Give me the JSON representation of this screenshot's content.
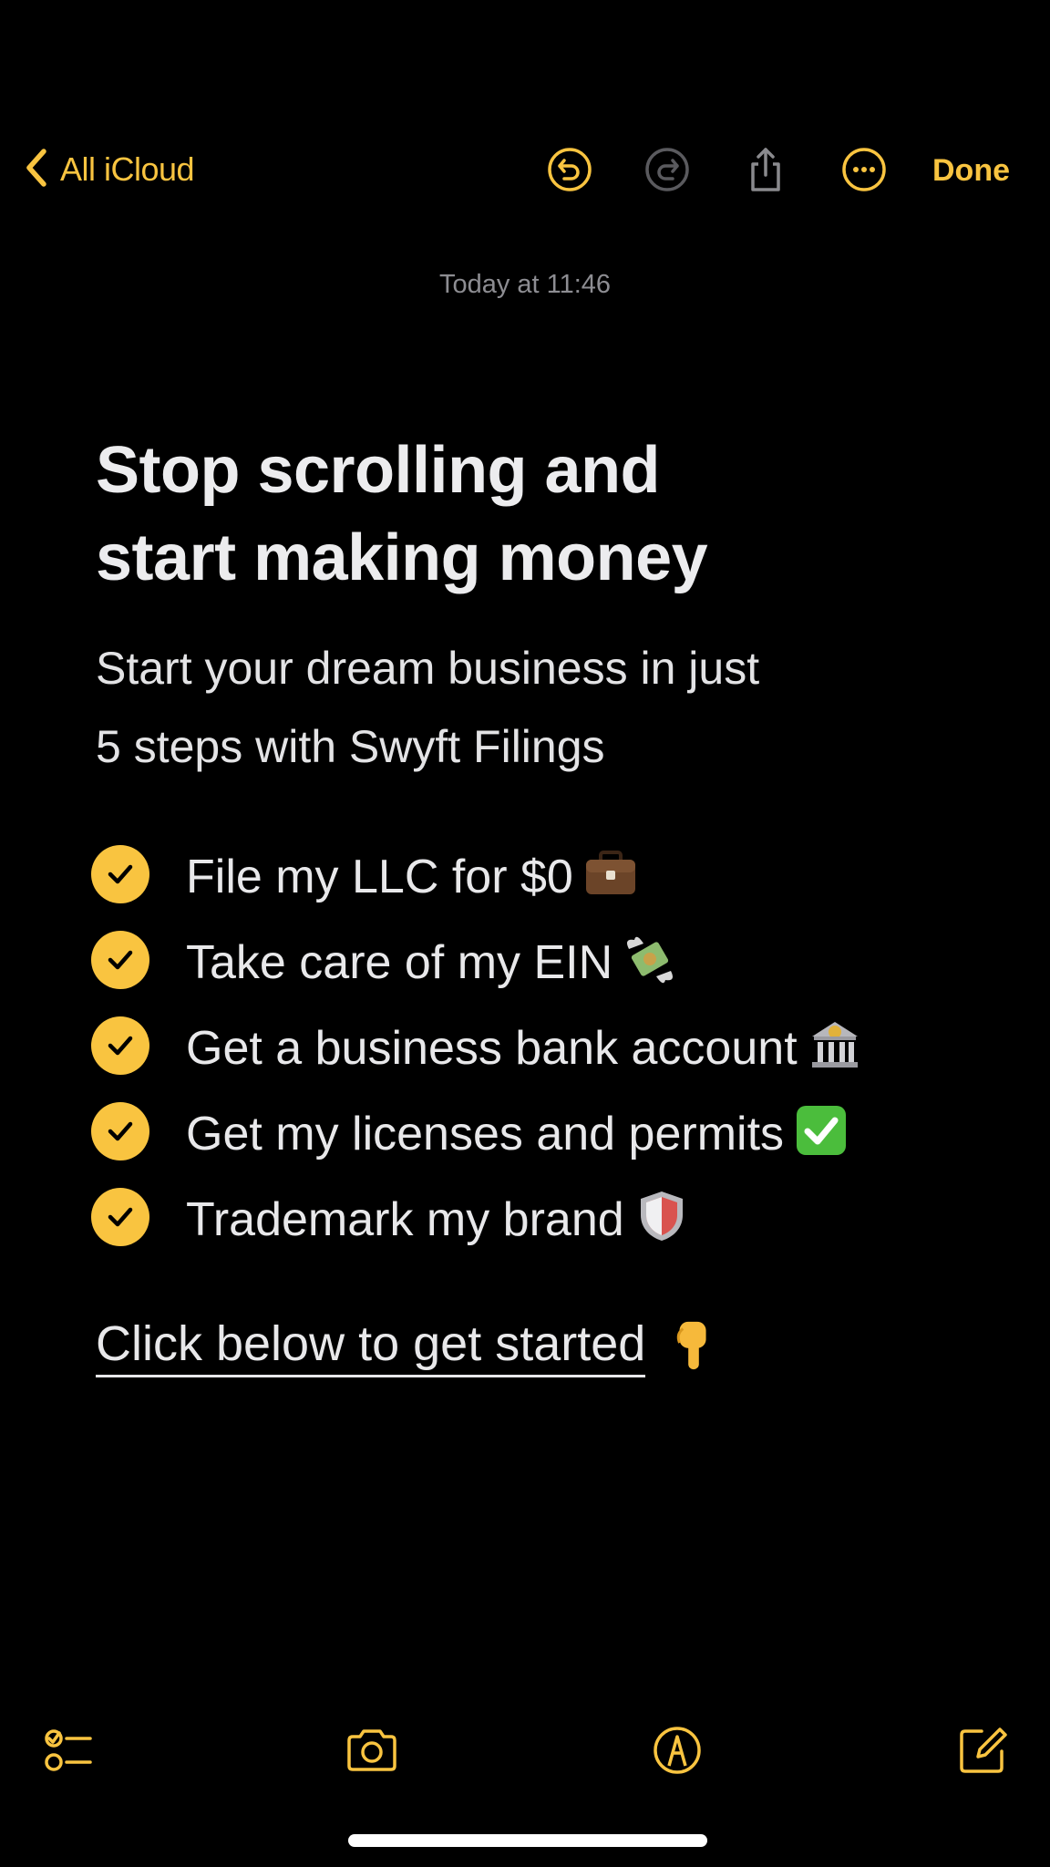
{
  "colors": {
    "accent": "#f9c440",
    "background": "#000000",
    "text": "#e8e8ea",
    "muted": "#8d8d92"
  },
  "nav": {
    "back_label": "All iCloud",
    "back_icon": "chevron-left-icon",
    "undo_icon": "undo-icon",
    "redo_icon": "redo-icon",
    "share_icon": "share-icon",
    "more_icon": "more-icon",
    "done_label": "Done"
  },
  "note": {
    "timestamp": "Today at 11:46",
    "title_line1": "Stop scrolling and",
    "title_line2": "start making money",
    "subtitle_line1": "Start your dream business in just",
    "subtitle_line2": "5 steps with Swyft Filings",
    "checklist": [
      {
        "text": "File my LLC for $0",
        "emoji": "briefcase",
        "checked": true
      },
      {
        "text": "Take care of my EIN",
        "emoji": "money-with-wings",
        "checked": true
      },
      {
        "text": "Get a business bank account",
        "emoji": "bank",
        "checked": true
      },
      {
        "text": "Get my licenses and permits",
        "emoji": "check-mark-button",
        "checked": true
      },
      {
        "text": "Trademark my brand",
        "emoji": "shield",
        "checked": true
      }
    ],
    "cta_label": "Click below to get started",
    "cta_emoji": "pointing-down"
  },
  "toolbar": {
    "checklist_icon": "checklist-icon",
    "camera_icon": "camera-icon",
    "markup_icon": "markup-icon",
    "compose_icon": "compose-icon"
  }
}
